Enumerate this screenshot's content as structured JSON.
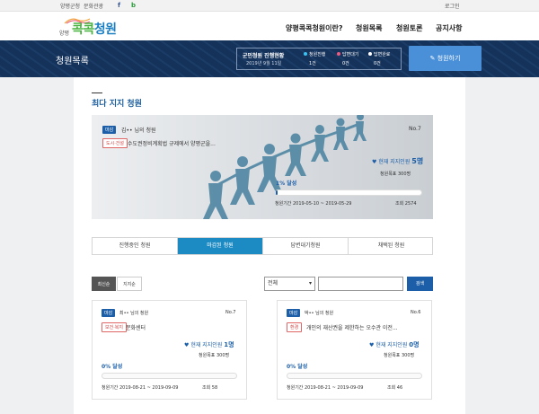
{
  "topbar": {
    "links": [
      "양평군청",
      "문화관광"
    ],
    "social": [
      "f",
      "b"
    ],
    "login": "로그인"
  },
  "header": {
    "logo_small": "양평",
    "logo_a": "콕콕",
    "logo_b": "청원",
    "nav": [
      "양평콕콕청원이란?",
      "청원목록",
      "청원토론",
      "공지사항"
    ]
  },
  "banner": {
    "title": "청원목록",
    "status_label": "군민청원 진행현황",
    "status_date": "2019년 9월 11일",
    "stats": [
      {
        "label": "청원진행",
        "value": "1건",
        "color": "#3fc1f0"
      },
      {
        "label": "답변대기",
        "value": "0건",
        "color": "#f05a7e"
      },
      {
        "label": "답변완료",
        "value": "0건",
        "color": "#ffffff"
      }
    ],
    "apply_button": "청원하기"
  },
  "featured": {
    "section_title": "최다 지지 청원",
    "status_badge": "마감",
    "author": "김•• 님의 청원",
    "number": "No.7",
    "category_badge": "도시·건설",
    "title": "수도권정비계획법 규제에서 양평군을...",
    "support_prefix": "현재 지지인원",
    "support_count": "5명",
    "goal": "청원목표 300명",
    "progress_text": "1% 달성",
    "progress": 0.01,
    "period": "청원기간 2019-05-10 ~ 2019-05-29",
    "views": "조회 2574"
  },
  "tabs": [
    "진행중인 청원",
    "마감된 청원",
    "답변대기청원",
    "채택된 청원"
  ],
  "active_tab": 1,
  "sort": [
    "최신순",
    "지지순"
  ],
  "filter": {
    "select_value": "전체",
    "search_button": "검색"
  },
  "cards": [
    {
      "status_badge": "마감",
      "author": "최•• 님의 청원",
      "number": "No.7",
      "category_badge": "보건·복지",
      "title": "문화센터",
      "support_prefix": "현재 지지인원",
      "support_count": "1명",
      "goal": "청원목표 300명",
      "progress_text": "0% 달성",
      "progress": 0.0,
      "period": "청원기간 2019-08-21 ~ 2019-09-09",
      "views": "조회 58"
    },
    {
      "status_badge": "마감",
      "author": "박•• 님의 청원",
      "number": "No.6",
      "category_badge": "환경",
      "title": "개인의 재산권을 제한하는 오수관 이전...",
      "support_prefix": "현재 지지인원",
      "support_count": "0명",
      "goal": "청원목표 300명",
      "progress_text": "0% 달성",
      "progress": 0.0,
      "period": "청원기간 2019-08-21 ~ 2019-09-09",
      "views": "조회 46"
    }
  ],
  "colors": {
    "primary": "#1c5fa8",
    "accent": "#1c8bc4",
    "banner": "#15325a"
  }
}
